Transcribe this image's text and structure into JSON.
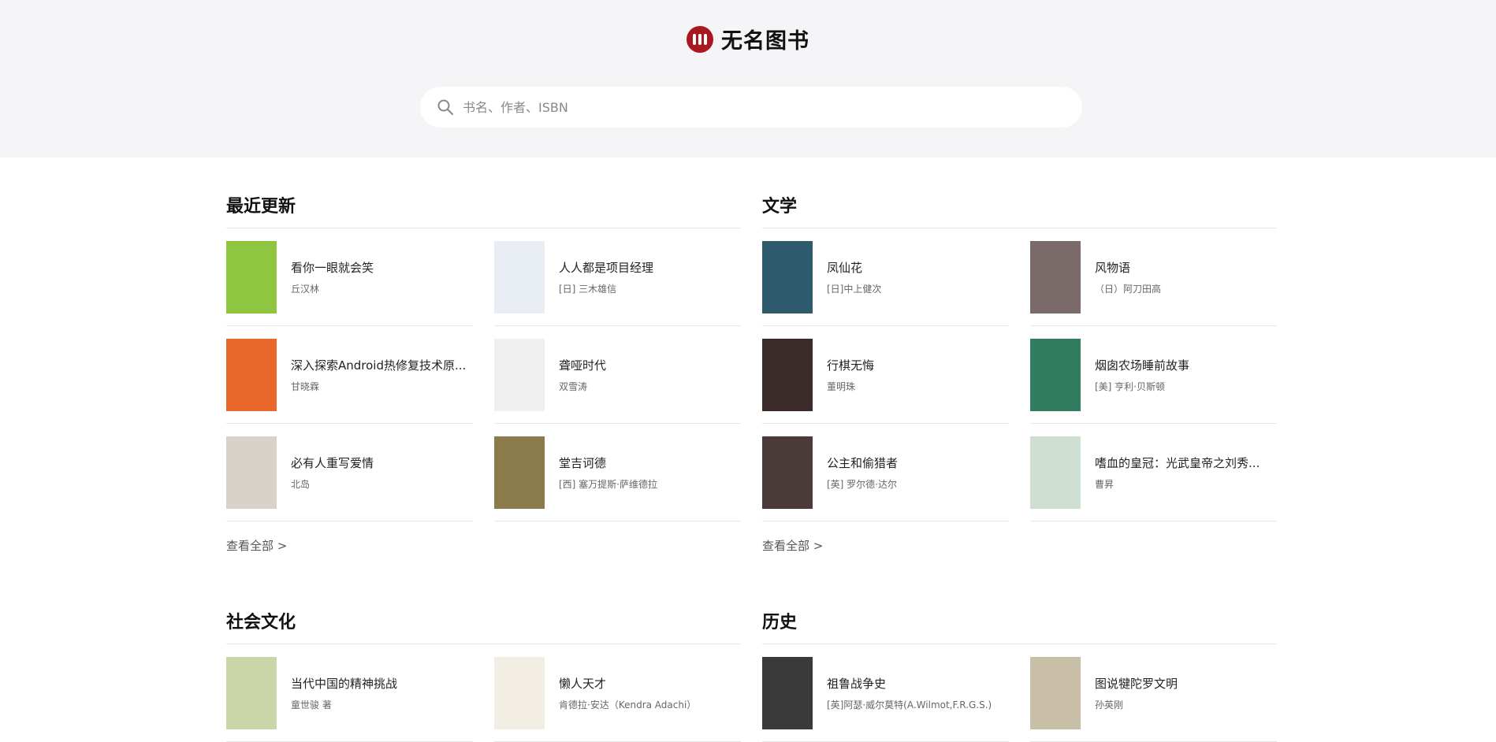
{
  "header": {
    "logo_text": "无名图书",
    "search_placeholder": "书名、作者、ISBN"
  },
  "sections": [
    {
      "title": "最近更新",
      "view_all": "查看全部 >",
      "books": [
        {
          "title": "看你一眼就会笑",
          "author": "丘汉林",
          "cover": "#8ec63f"
        },
        {
          "title": "人人都是项目经理",
          "author": "[日] 三木雄信",
          "cover": "#e8eef3"
        },
        {
          "title": "深入探索Android热修复技术原...",
          "author": "甘晓霖",
          "cover": "#e9672a"
        },
        {
          "title": "聋哑时代",
          "author": "双雪涛",
          "cover": "#f0f0f0"
        },
        {
          "title": "必有人重写爱情",
          "author": "北岛",
          "cover": "#d8d3c8"
        },
        {
          "title": "堂吉诃德",
          "author": "[西] 塞万提斯·萨维德拉",
          "cover": "#8b7a4a"
        }
      ]
    },
    {
      "title": "文学",
      "view_all": "查看全部 >",
      "books": [
        {
          "title": "凤仙花",
          "author": "[日]中上健次",
          "cover": "#2e5a6e"
        },
        {
          "title": "风物语",
          "author": "（日）阿刀田高",
          "cover": "#7a6a6a"
        },
        {
          "title": "行棋无悔",
          "author": "董明珠",
          "cover": "#3a2a2a"
        },
        {
          "title": "烟囱农场睡前故事",
          "author": "[美] 亨利·贝斯顿",
          "cover": "#2f7d5e"
        },
        {
          "title": "公主和偷猎者",
          "author": "[英] 罗尔德·达尔",
          "cover": "#4a3a3a"
        },
        {
          "title": "嗜血的皇冠：光武皇帝之刘秀...",
          "author": "曹昇",
          "cover": "#cfe0d2"
        }
      ]
    },
    {
      "title": "社会文化",
      "view_all": "",
      "books": [
        {
          "title": "当代中国的精神挑战",
          "author": "童世骏 著",
          "cover": "#cbd6a8"
        },
        {
          "title": "懒人天才",
          "author": "肯德拉·安达（Kendra Adachi）",
          "cover": "#f3eee4"
        }
      ]
    },
    {
      "title": "历史",
      "view_all": "",
      "books": [
        {
          "title": "祖鲁战争史",
          "author": "[英]阿瑟·威尔莫特(A.Wilmot,F.R.G.S.)",
          "cover": "#3a3a3a"
        },
        {
          "title": "图说犍陀罗文明",
          "author": "孙英刚",
          "cover": "#c9bfa7"
        }
      ]
    }
  ]
}
